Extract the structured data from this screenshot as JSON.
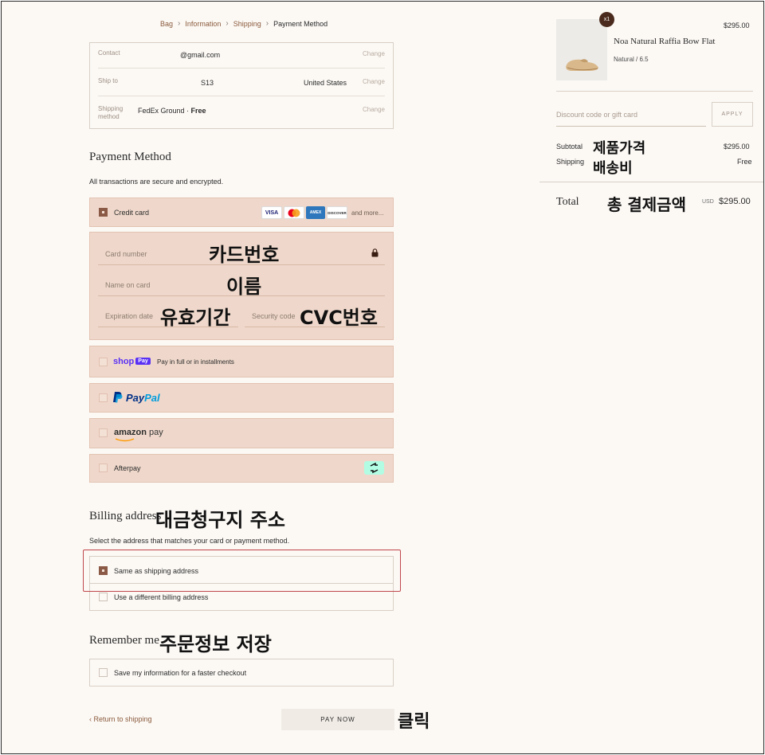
{
  "breadcrumb": [
    "Bag",
    "Information",
    "Shipping",
    "Payment Method"
  ],
  "info": {
    "contact_label": "Contact",
    "contact_value": "@gmail.com",
    "shipto_label": "Ship to",
    "shipto_zip": "S13",
    "shipto_country": "United States",
    "method_label": "Shipping method",
    "method_value": "FedEx Ground · ",
    "method_free": "Free",
    "change": "Change"
  },
  "payment": {
    "title": "Payment Method",
    "subtitle": "All transactions are secure and encrypted.",
    "credit_card_label": "Credit card",
    "card_logos": [
      "VISA",
      "AMEX",
      "DISCOVER"
    ],
    "more": "and more...",
    "card_number_placeholder": "Card number",
    "name_placeholder": "Name on card",
    "expiry_placeholder": "Expiration date",
    "security_placeholder": "Security code",
    "shoppay_brand": "shop",
    "shoppay_badge": "Pay",
    "shoppay_text": "Pay in full or in installments",
    "paypal_brand_a": "Pay",
    "paypal_brand_b": "Pal",
    "amazon_brand": "amazon",
    "amazon_pay": "pay",
    "afterpay_label": "Afterpay"
  },
  "billing": {
    "title": "Billing address",
    "subtitle": "Select the address that matches your card or payment method.",
    "same_label": "Same as shipping address",
    "different_label": "Use a different billing address"
  },
  "remember": {
    "title": "Remember me",
    "save_label": "Save my information for a faster checkout"
  },
  "actions": {
    "return_label": "Return to shipping",
    "pay_label": "PAY NOW"
  },
  "order": {
    "quantity": "x1",
    "product_name": "Noa Natural Raffia Bow Flat",
    "variant": "Natural / 6.5",
    "product_price": "$295.00",
    "discount_placeholder": "Discount code or gift card",
    "apply_label": "APPLY",
    "subtotal_label": "Subtotal",
    "subtotal_value": "$295.00",
    "shipping_label": "Shipping",
    "shipping_value": "Free",
    "total_label": "Total",
    "currency": "USD",
    "total_value": "$295.00"
  },
  "annotations": {
    "card_number": "카드번호",
    "name": "이름",
    "expiry": "유효기간",
    "cvc": "CVC번호",
    "billing": "대금청구지 주소",
    "remember": "주문정보 저장",
    "click": "클릭",
    "subtotal": "제품가격",
    "shipping": "배송비",
    "total": "총 결제금액"
  },
  "colors": {
    "accent": "#8b5a46",
    "option_bg": "#efd8cb",
    "page_bg": "#fcf9f5",
    "highlight": "#c0464b"
  }
}
